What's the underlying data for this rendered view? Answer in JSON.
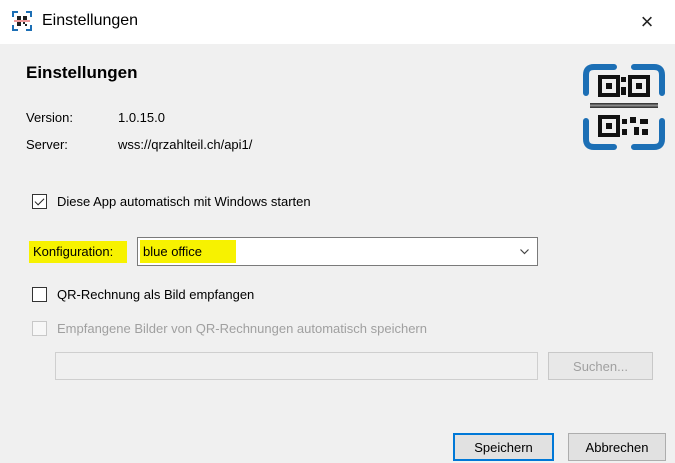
{
  "window": {
    "title": "Einstellungen",
    "close_label": "×"
  },
  "heading": "Einstellungen",
  "info": {
    "version_label": "Version:",
    "version_value": "1.0.15.0",
    "server_label": "Server:",
    "server_value": "wss://qrzahlteil.ch/api1/"
  },
  "autostart": {
    "label": "Diese App automatisch mit Windows starten",
    "checked": true
  },
  "configuration": {
    "label": "Konfiguration:",
    "selected": "blue office"
  },
  "qr_image": {
    "label": "QR-Rechnung als Bild empfangen",
    "checked": false
  },
  "auto_save": {
    "label": "Empfangene Bilder von QR-Rechnungen automatisch speichern",
    "checked": false,
    "disabled": true,
    "path_value": ""
  },
  "buttons": {
    "browse": "Suchen...",
    "save": "Speichern",
    "cancel": "Abbrechen"
  },
  "colors": {
    "highlight": "#f7f200",
    "logo_blue": "#1c6fb5",
    "accent": "#0078d7"
  }
}
